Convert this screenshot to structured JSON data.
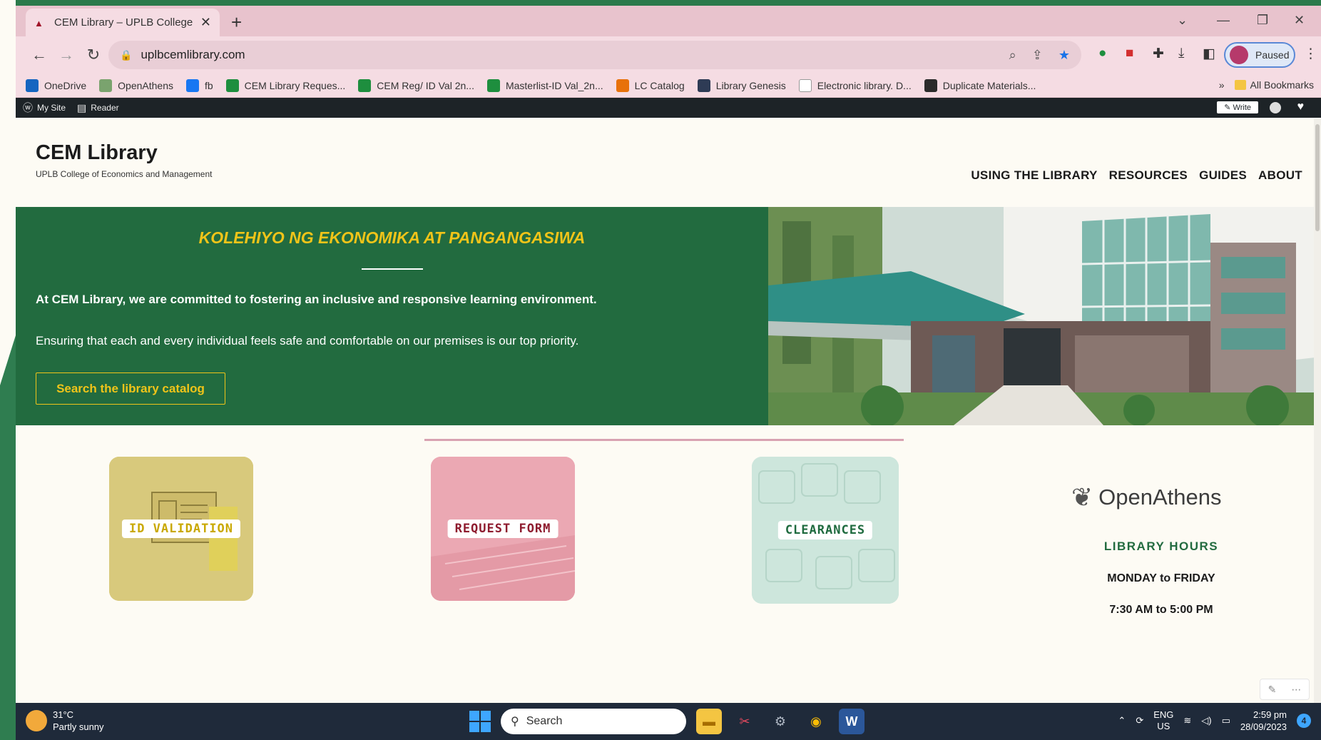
{
  "browser": {
    "tab_title": "CEM Library – UPLB College of E",
    "url": "uplbcemlibrary.com",
    "profile_status": "Paused",
    "bookmarks": [
      {
        "label": "OneDrive",
        "color": "#1565c0"
      },
      {
        "label": "OpenAthens",
        "color": "#7aa36e"
      },
      {
        "label": "fb",
        "color": "#1877f2"
      },
      {
        "label": "CEM Library Reques...",
        "color": "#1e8e3e"
      },
      {
        "label": "CEM Reg/ ID Val 2n...",
        "color": "#1e8e3e"
      },
      {
        "label": "Masterlist-ID Val_2n...",
        "color": "#1e8e3e"
      },
      {
        "label": "LC Catalog",
        "color": "#e8710a"
      },
      {
        "label": "Library Genesis",
        "color": "#2e3b55"
      },
      {
        "label": "Electronic library. D...",
        "color": "#ffffff"
      },
      {
        "label": "Duplicate Materials...",
        "color": "#2b2b2b"
      }
    ],
    "bookmarks_more": "»",
    "all_bookmarks": "All Bookmarks"
  },
  "wp_admin": {
    "my_site": "My Site",
    "reader": "Reader",
    "write": "Write"
  },
  "site": {
    "title": "CEM Library",
    "subtitle": "UPLB College of Economics and Management",
    "nav": [
      "USING THE LIBRARY",
      "RESOURCES",
      "GUIDES",
      "ABOUT"
    ]
  },
  "hero": {
    "heading": "KOLEHIYO NG EKONOMIKA AT PANGANGASIWA",
    "p1": "At CEM Library, we are committed to fostering an inclusive and responsive learning environment.",
    "p2": "Ensuring that each and every individual feels safe and comfortable on our premises is our top priority.",
    "button": "Search the library catalog"
  },
  "cards": [
    {
      "label": "ID VALIDATION",
      "color": "#c9a800"
    },
    {
      "label": "REQUEST FORM",
      "color": "#8e1b2e"
    },
    {
      "label": "CLEARANCES",
      "color": "#1f6b3f"
    }
  ],
  "sidebar": {
    "openathens": "OpenAthens",
    "hours_title": "LIBRARY HOURS",
    "days": "MONDAY to FRIDAY",
    "time": "7:30 AM to 5:00 PM"
  },
  "taskbar": {
    "temp": "31°C",
    "weather": "Partly sunny",
    "search": "Search",
    "lang1": "ENG",
    "lang2": "US",
    "time": "2:59 pm",
    "date": "28/09/2023",
    "notif": "4"
  },
  "colors": {
    "brand_green": "#226b3f",
    "accent_yellow": "#f0c419",
    "tab_pink": "#e8c3cd"
  }
}
